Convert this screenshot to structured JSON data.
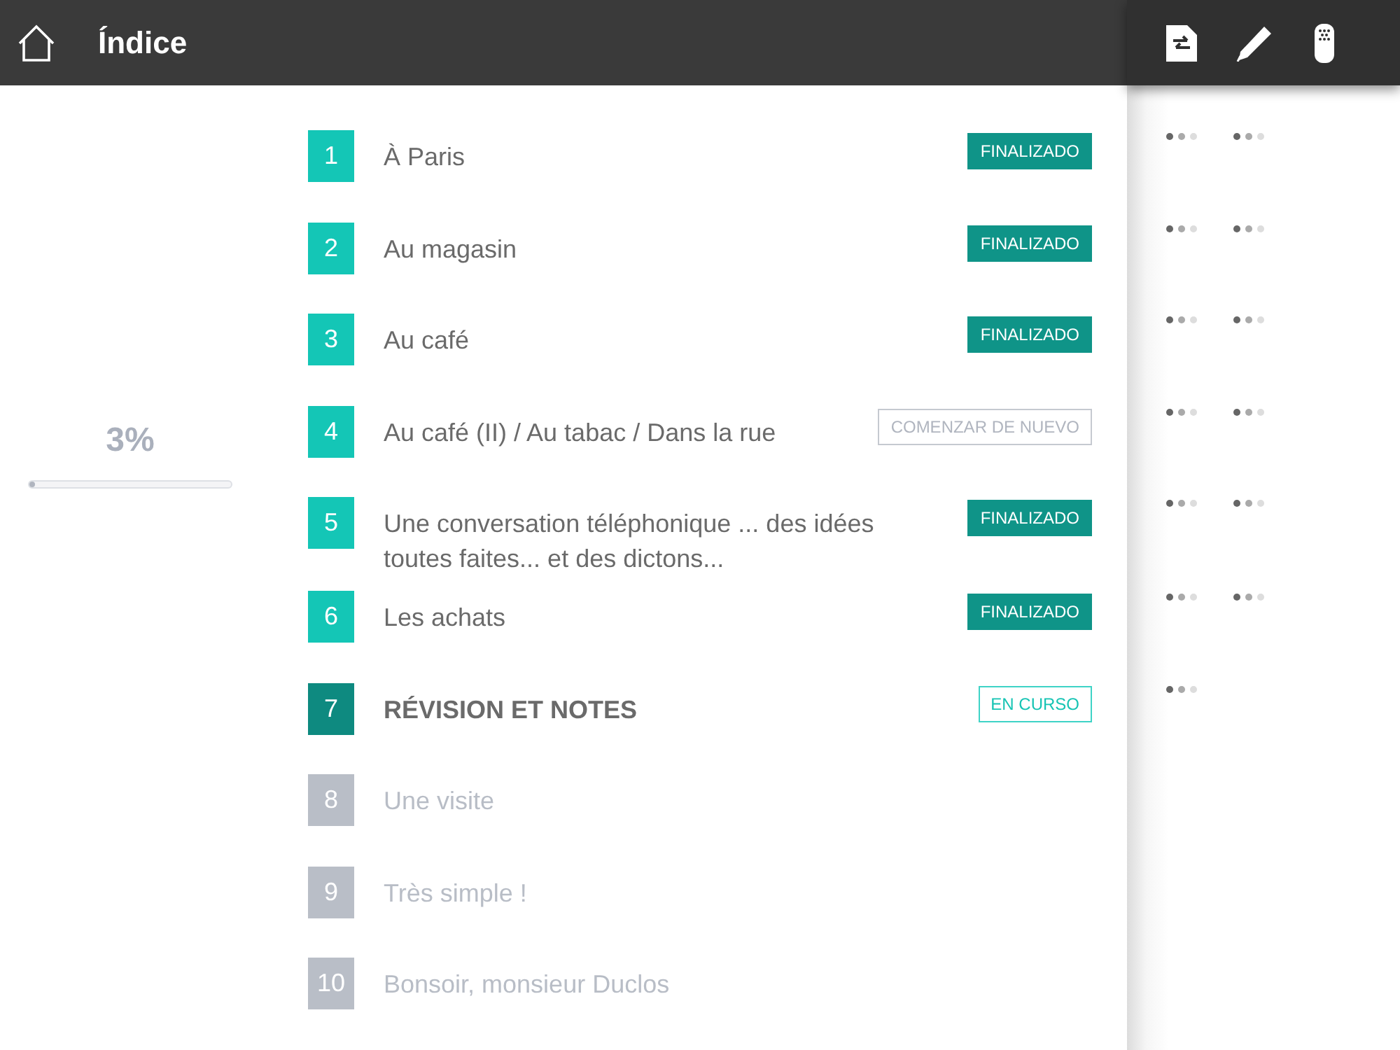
{
  "header": {
    "title": "Índice"
  },
  "progress": {
    "reading": "3%",
    "level": 0.03
  },
  "lessons": [
    {
      "number": "1",
      "title": "À Paris",
      "kind": "done",
      "badge": "FINALIZADO",
      "indicators": [
        {
          "kind": "dots"
        },
        {
          "kind": "dots"
        }
      ]
    },
    {
      "number": "2",
      "title": "Au magasin",
      "kind": "done",
      "badge": "FINALIZADO",
      "indicators": [
        {
          "kind": "dots"
        },
        {
          "kind": "dots"
        }
      ]
    },
    {
      "number": "3",
      "title": "Au café",
      "kind": "done",
      "badge": "FINALIZADO",
      "indicators": [
        {
          "kind": "dots"
        },
        {
          "kind": "dots"
        }
      ]
    },
    {
      "number": "4",
      "title": "Au café (II) / Au tabac / Dans la rue",
      "kind": "restart",
      "badge": "COMENZAR DE NUEVO",
      "indicators": [
        {
          "kind": "dots"
        },
        {
          "kind": "dots"
        }
      ]
    },
    {
      "number": "5",
      "title": "Une conversation téléphonique ... des idées toutes faites... et des dictons...",
      "kind": "done",
      "badge": "FINALIZADO",
      "indicators": [
        {
          "kind": "dots"
        },
        {
          "kind": "dots"
        }
      ]
    },
    {
      "number": "6",
      "title": "Les achats",
      "kind": "done",
      "badge": "FINALIZADO",
      "indicators": [
        {
          "kind": "dots"
        },
        {
          "kind": "dots"
        }
      ]
    },
    {
      "number": "7",
      "title": "RÉVISION ET NOTES",
      "kind": "in_progress",
      "badge": "EN CURSO",
      "indicators": [
        {
          "kind": "dots"
        }
      ]
    },
    {
      "number": "8",
      "title": "Une visite",
      "kind": "locked"
    },
    {
      "number": "9",
      "title": "Très simple !",
      "kind": "locked"
    },
    {
      "number": "10",
      "title": "Bonsoir, monsieur Duclos",
      "kind": "locked"
    }
  ]
}
